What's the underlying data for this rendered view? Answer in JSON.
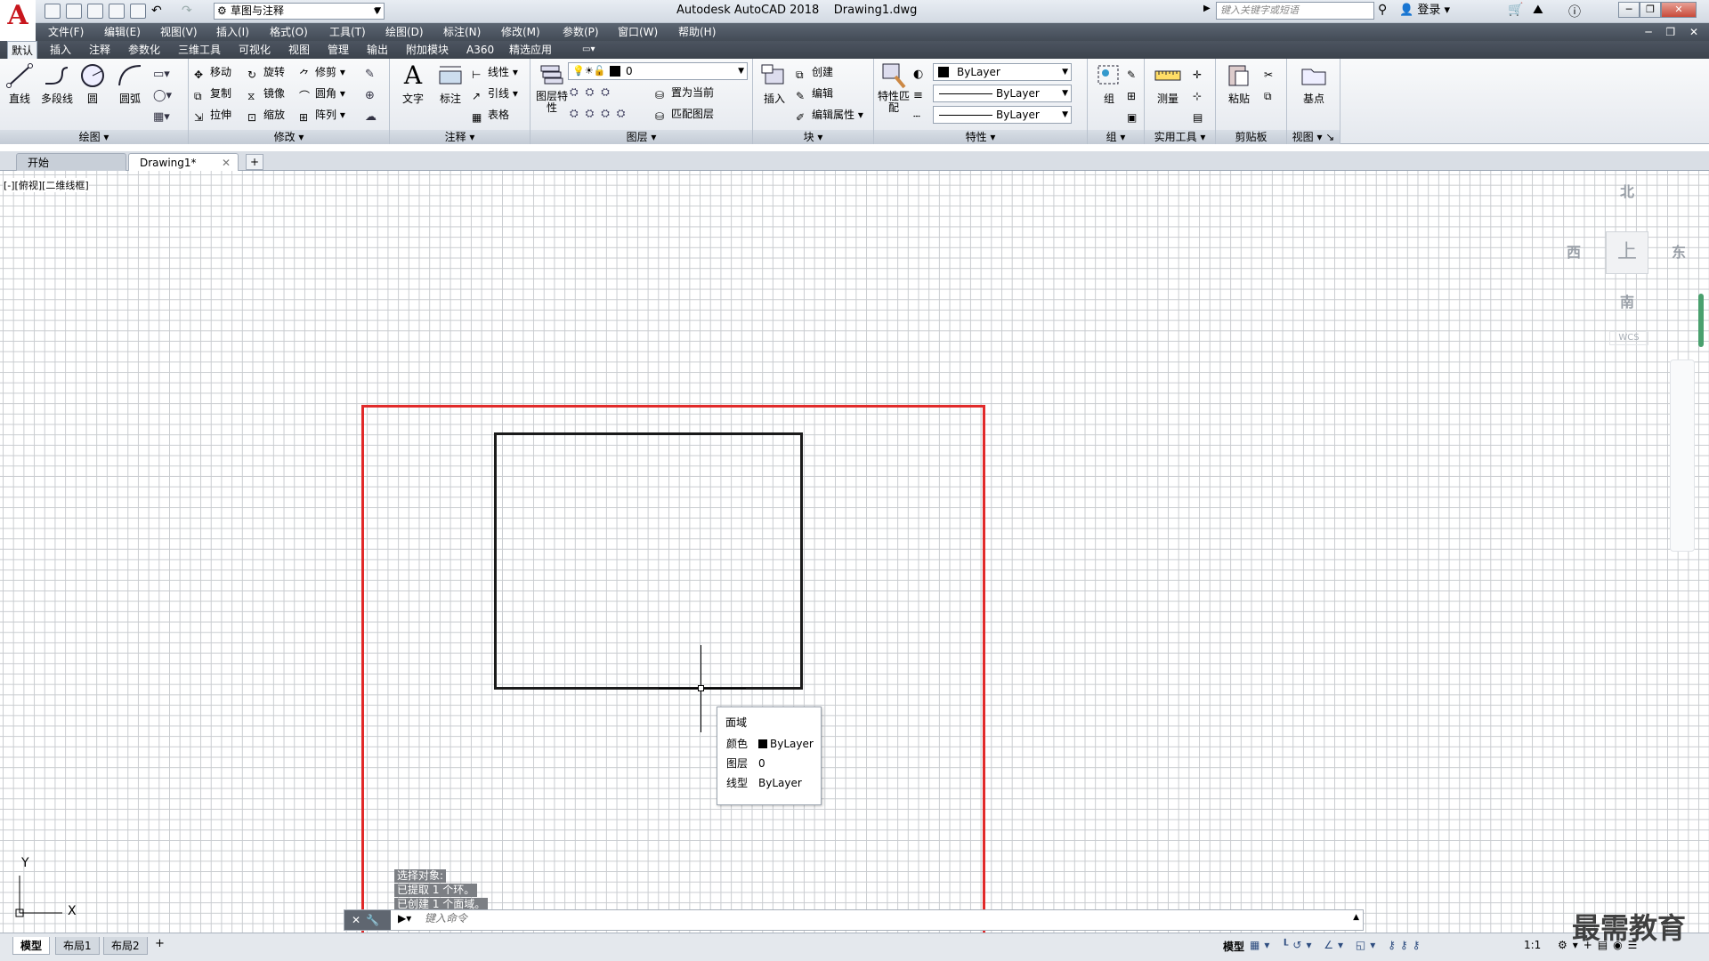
{
  "app": {
    "logo_letter": "A",
    "title": "Autodesk AutoCAD 2018    Drawing1.dwg",
    "workspace": "草图与注释",
    "search_placeholder": "键入关键字或短语",
    "login": "登录"
  },
  "menus": [
    "文件(F)",
    "编辑(E)",
    "视图(V)",
    "插入(I)",
    "格式(O)",
    "工具(T)",
    "绘图(D)",
    "标注(N)",
    "修改(M)",
    "参数(P)",
    "窗口(W)",
    "帮助(H)"
  ],
  "ribbon_tabs": [
    "默认",
    "插入",
    "注释",
    "参数化",
    "三维工具",
    "可视化",
    "视图",
    "管理",
    "输出",
    "附加模块",
    "A360",
    "精选应用"
  ],
  "active_ribbon_tab": "默认",
  "panels": {
    "draw": {
      "title": "绘图",
      "tools": [
        "直线",
        "多段线",
        "圆",
        "圆弧"
      ]
    },
    "modify": {
      "title": "修改",
      "tools": [
        "移动",
        "旋转",
        "修剪",
        "复制",
        "镜像",
        "圆角",
        "拉伸",
        "缩放",
        "阵列"
      ]
    },
    "annotation": {
      "title": "注释",
      "tools": [
        "文字",
        "标注",
        "线性",
        "引线",
        "表格"
      ]
    },
    "layers": {
      "title": "图层",
      "tools": [
        "图层特性",
        "置为当前",
        "匹配图层"
      ],
      "current_layer": "0"
    },
    "block": {
      "title": "块",
      "tools": [
        "插入",
        "创建",
        "编辑",
        "编辑属性"
      ]
    },
    "properties": {
      "title": "特性",
      "tools": [
        "特性匹配"
      ],
      "color": "ByLayer",
      "linetype": "ByLayer",
      "lineweight": "ByLayer"
    },
    "groups": {
      "title": "组",
      "tools": [
        "组"
      ]
    },
    "utilities": {
      "title": "实用工具",
      "tools": [
        "测量"
      ]
    },
    "clipboard": {
      "title": "剪贴板",
      "tools": [
        "粘贴"
      ]
    },
    "view": {
      "title": "视图",
      "tools": [
        "基点"
      ]
    }
  },
  "file_tabs": [
    "开始",
    "Drawing1*"
  ],
  "viewport_label": "[-][俯视][二维线框]",
  "viewcube": {
    "north": "北",
    "south": "南",
    "east": "东",
    "west": "西",
    "face": "上",
    "wcs": "WCS"
  },
  "tooltip": {
    "title": "面域",
    "rows": [
      {
        "key": "颜色",
        "value": "ByLayer"
      },
      {
        "key": "图层",
        "value": "0"
      },
      {
        "key": "线型",
        "value": "ByLayer"
      }
    ]
  },
  "ucs": {
    "x": "X",
    "y": "Y"
  },
  "command_history": [
    "选择对象:",
    "已提取 1 个环。",
    "已创建 1 个面域。"
  ],
  "command_placeholder": "键入命令",
  "layout_tabs": [
    "模型",
    "布局1",
    "布局2"
  ],
  "status": {
    "model": "模型",
    "scale": "1:1"
  },
  "watermark": "最需教育",
  "colors": {
    "frame": "#e12a2a",
    "brand": "#c8161d"
  }
}
